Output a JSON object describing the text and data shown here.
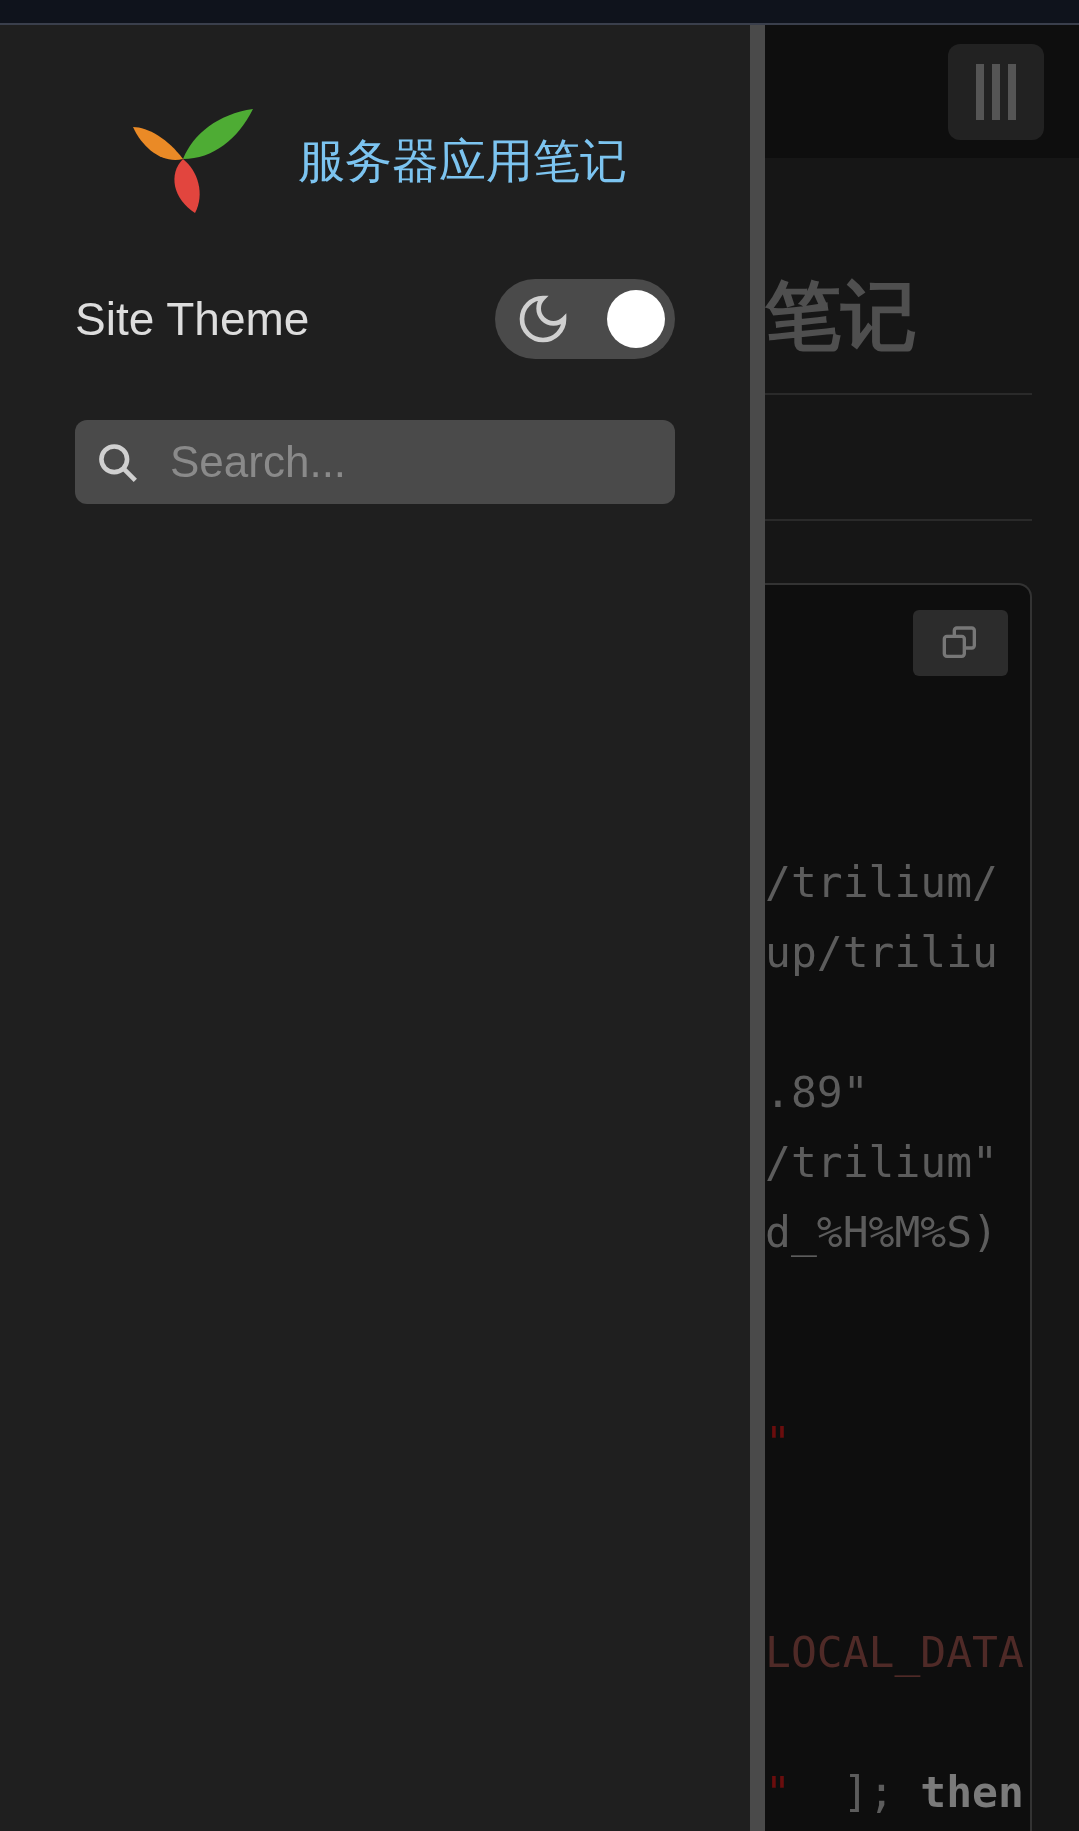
{
  "sidebar": {
    "title": "服务器应用笔记",
    "theme_label": "Site Theme",
    "dark_mode": true,
    "search": {
      "placeholder": "Search..."
    }
  },
  "page": {
    "title": "笔记",
    "code_lines": [
      {
        "kind": "blank"
      },
      {
        "kind": "blank"
      },
      {
        "kind": "blank"
      },
      {
        "kind": "code",
        "tokens": [
          {
            "kind": "plain",
            "text": "/trilium/"
          }
        ]
      },
      {
        "kind": "code",
        "tokens": [
          {
            "kind": "plain",
            "text": "up/triliu"
          }
        ]
      },
      {
        "kind": "blank"
      },
      {
        "kind": "code",
        "tokens": [
          {
            "kind": "plain",
            "text": ".89\""
          }
        ]
      },
      {
        "kind": "code",
        "tokens": [
          {
            "kind": "plain",
            "text": "/trilium\""
          }
        ]
      },
      {
        "kind": "code",
        "tokens": [
          {
            "kind": "plain",
            "text": "d_%H%M%S)"
          }
        ]
      },
      {
        "kind": "blank"
      },
      {
        "kind": "blank"
      },
      {
        "kind": "code",
        "tokens": [
          {
            "kind": "quote",
            "text": "\""
          }
        ]
      },
      {
        "kind": "blank"
      },
      {
        "kind": "blank"
      },
      {
        "kind": "code",
        "tokens": [
          {
            "kind": "string",
            "text": "LOCAL_DATA"
          }
        ]
      },
      {
        "kind": "blank"
      },
      {
        "kind": "code",
        "tokens": [
          {
            "kind": "quote",
            "text": "\""
          },
          {
            "kind": "plain",
            "text": "  ];"
          },
          {
            "kind": "keyword",
            "text": " then"
          }
        ]
      }
    ]
  }
}
